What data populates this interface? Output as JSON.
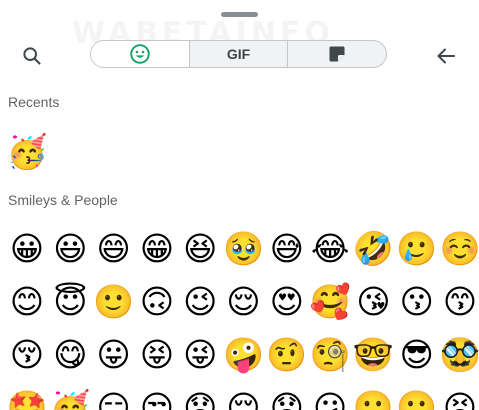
{
  "watermark": "WABETAINFO",
  "tabs": [
    {
      "type": "emoji",
      "icon": "smiley-icon",
      "active": true
    },
    {
      "type": "gif",
      "label": "GIF",
      "active": false
    },
    {
      "type": "sticker",
      "icon": "sticker-icon",
      "active": false
    }
  ],
  "colors": {
    "accent": "#19a06a",
    "icon": "#41484c",
    "tab_border": "#c3c7ca",
    "section_text": "#5f6368"
  },
  "sections": {
    "recents": {
      "title": "Recents",
      "emojis": [
        "🥳"
      ]
    },
    "smileys_people": {
      "title": "Smileys & People",
      "emojis": [
        "😀",
        "😃",
        "😄",
        "😁",
        "😆",
        "🥹",
        "😅",
        "😂",
        "🤣",
        "🥲",
        "☺️",
        "😊",
        "😇",
        "🙂",
        "🙃",
        "😉",
        "😌",
        "😍",
        "🥰",
        "😘",
        "😗",
        "😙",
        "😚",
        "😋",
        "😛",
        "😝",
        "😜",
        "🤪",
        "🤨",
        "🧐",
        "🤓",
        "😎",
        "🥸",
        "🤩",
        "🥳",
        "😏",
        "😒",
        "😞",
        "😔",
        "😟",
        "😕",
        "🙁",
        "☹️",
        "😣"
      ]
    }
  }
}
